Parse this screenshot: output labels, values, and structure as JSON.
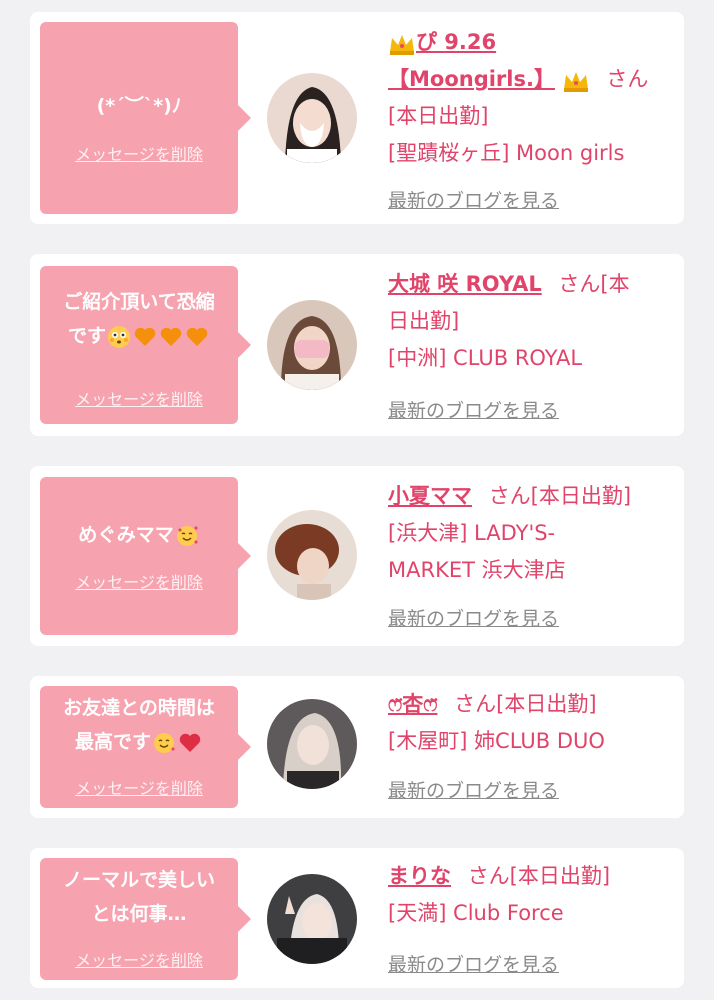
{
  "delete_label": "メッセージを削除",
  "blog_label": "最新のブログを見る",
  "san": "さん",
  "cards": [
    {
      "message": "(*´︶`*)ﾉ",
      "name_line1": "ぴ 9.26",
      "name_line2": "【Moongirls.】",
      "status": "[本日出勤]",
      "shop": "[聖蹟桜ヶ丘] Moon girls",
      "icons": [
        "crown-icon",
        "crown-icon"
      ]
    },
    {
      "message_line1": "ご紹介頂いて恐縮",
      "message_line2": "です",
      "name": "大城 咲 ROYAL",
      "san_status": "さん[本",
      "status2": "日出勤]",
      "shop": "[中洲] CLUB ROYAL",
      "icons": [
        "flushed-face-icon",
        "orange-heart-icon",
        "orange-heart-icon",
        "orange-heart-icon"
      ]
    },
    {
      "message": "めぐみママ",
      "name": "小夏ママ",
      "san_status": "さん[本日出勤]",
      "shop_line1": "[浜大津] LADY'S-",
      "shop_line2": "MARKET 浜大津店",
      "icons": [
        "smiling-face-with-hearts-icon"
      ]
    },
    {
      "message_line1": "お友達との時間は",
      "message_line2": "最高です",
      "name": "ෆ̈杏ෆ̈",
      "san_status": "さん[本日出勤]",
      "shop": "[木屋町] 姉CLUB DUO",
      "icons": [
        "smiling-face-with-hearts-icon",
        "red-heart-icon"
      ]
    },
    {
      "message_line1": "ノーマルで美しい",
      "message_line2": "とは何事…",
      "name": "まりな",
      "san_status": "さん[本日出勤]",
      "shop": "[天満] Club Force"
    }
  ],
  "colors": {
    "bubble": "#f7a2af",
    "name": "#e0446a",
    "link_gray": "#8a8a8a",
    "background": "#f1f1f3"
  }
}
